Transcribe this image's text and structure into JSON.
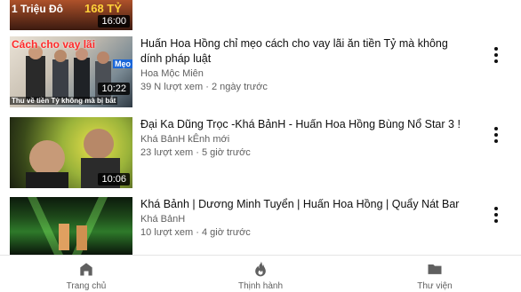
{
  "videos": [
    {
      "thumb_text": [
        "1 Triệu Đô",
        "168 TỶ"
      ],
      "duration": "16:00"
    },
    {
      "title": "Huấn Hoa Hồng chỉ mẹo cách cho vay lãi ăn tiền Tỷ mà không dính pháp luật",
      "channel": "Hoa Mộc Miên",
      "meta": "39 N lượt xem · 2 ngày trước",
      "duration": "10:22",
      "thumb_text": [
        "Cách cho vay lãi",
        "Thu về tiền Tỷ không mà bị bắt",
        "Mẹo"
      ]
    },
    {
      "title": "Đại Ka Dũng Trọc -Khá BảnH - Huấn Hoa Hồng Bùng Nổ Star 3 !",
      "channel": "Khá BảnH kÊnh mới",
      "meta": "23 lượt xem · 5 giờ trước",
      "duration": "10:06"
    },
    {
      "title": "Khá Bảnh | Dương Minh Tuyển | Huấn Hoa Hồng | Quẩy Nát Bar",
      "channel": "Khá BảnH",
      "meta": "10 lượt xem · 4 giờ trước"
    }
  ],
  "bottom_nav": [
    {
      "label": "Trang chủ",
      "icon": "home-icon"
    },
    {
      "label": "Thịnh hành",
      "icon": "trending-icon"
    },
    {
      "label": "Thư viện",
      "icon": "library-icon"
    }
  ],
  "colors": {
    "text_primary": "#0f0f0f",
    "text_secondary": "#606060",
    "divider": "#e5e5e5"
  }
}
